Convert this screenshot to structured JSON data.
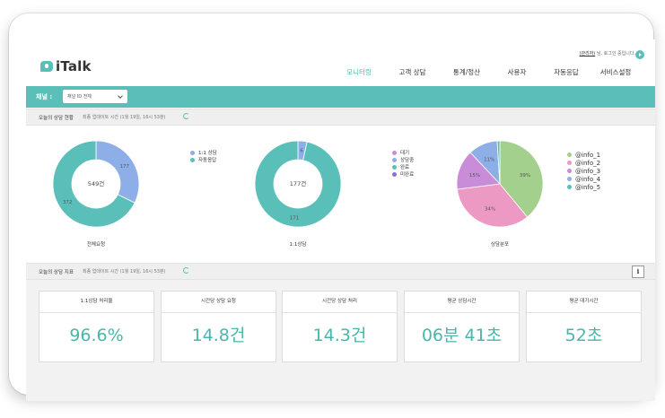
{
  "header": {
    "logo_text": "iTalk",
    "user_name": "(관리자)",
    "user_suffix": " 님, 로그인 중입니다.",
    "nav": [
      {
        "label": "모니터링",
        "active": true
      },
      {
        "label": "고객 상담",
        "active": false
      },
      {
        "label": "통계/정산",
        "active": false
      },
      {
        "label": "사용자",
        "active": false
      },
      {
        "label": "자동응답",
        "active": false
      },
      {
        "label": "서비스설정",
        "active": false
      }
    ]
  },
  "channel": {
    "label": "채널 :",
    "selected": "채널 ID 전체"
  },
  "status_section": {
    "title": "오늘의 상담 현황",
    "update_text": "최종 업데이트 시간 (1월 19일, 16시 53분)"
  },
  "indicator_section": {
    "title": "오늘의 상담 지표",
    "update_text": "최종 업데이트 시간 (1월 19일, 16시 53분)",
    "info_label": "i"
  },
  "chart_data": [
    {
      "type": "pie",
      "title": "전체요청",
      "center_label": "549건",
      "categories": [
        "1:1 상담",
        "자동응답"
      ],
      "values": [
        177,
        372
      ],
      "colors": [
        "#8eaee8",
        "#5bbfb9"
      ],
      "donut": true
    },
    {
      "type": "pie",
      "title": "1:1상담",
      "center_label": "177건",
      "categories": [
        "대기",
        "상담중",
        "완료",
        "미완료"
      ],
      "values": [
        0,
        6,
        171,
        0
      ],
      "colors": [
        "#c98cd8",
        "#8eaee8",
        "#5bbfb9",
        "#8e6fd8"
      ],
      "data_labels": [
        "",
        "6",
        "171",
        ""
      ],
      "donut": true
    },
    {
      "type": "pie",
      "title": "상담분포",
      "categories": [
        "@info_1",
        "@info_2",
        "@info_3",
        "@info_4",
        "@info_5"
      ],
      "values": [
        39,
        34,
        15,
        11,
        1
      ],
      "colors": [
        "#a3d08d",
        "#ec9ac4",
        "#c98cd8",
        "#8eaee8",
        "#5bbfb9"
      ],
      "data_labels": [
        "39%",
        "34%",
        "15%",
        "11%",
        ""
      ],
      "donut": false
    }
  ],
  "stats": [
    {
      "title": "1:1상담 처리율",
      "value": "96.6%"
    },
    {
      "title": "시간당 상담 요청",
      "value": "14.8건"
    },
    {
      "title": "시간당 상담 처리",
      "value": "14.3건"
    },
    {
      "title": "평균 상담시간",
      "value": "06분 41초"
    },
    {
      "title": "평균 대기시간",
      "value": "52초"
    }
  ]
}
